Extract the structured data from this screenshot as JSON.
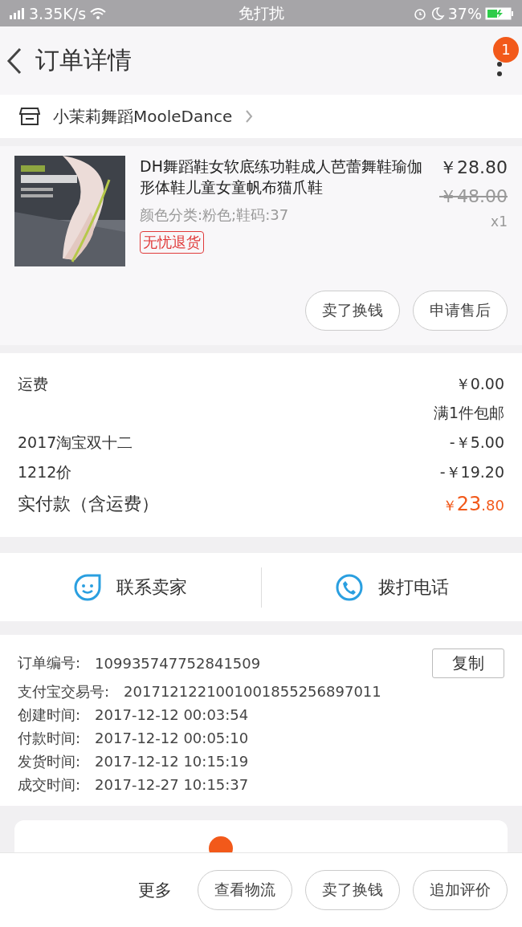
{
  "status_bar": {
    "speed": "3.35K/s",
    "mode": "免打扰",
    "battery": "37%"
  },
  "header": {
    "title": "订单详情",
    "badge": "1"
  },
  "shop": {
    "name": "小茉莉舞蹈MooleDance"
  },
  "product": {
    "title": "DH舞蹈鞋女软底练功鞋成人芭蕾舞鞋瑜伽形体鞋儿童女童帆布猫爪鞋",
    "variant": "颜色分类:粉色;鞋码:37",
    "tag": "无忧退货",
    "price": "￥28.80",
    "original_price": "￥48.00",
    "quantity": "x1",
    "buttons": [
      "卖了换钱",
      "申请售后"
    ]
  },
  "fees": [
    {
      "label": "运费",
      "value": "￥0.00",
      "kind": "plain"
    },
    {
      "value": "满1件包邮",
      "kind": "note"
    },
    {
      "label": "2017淘宝双十二",
      "value": "-￥5.00",
      "kind": "plain"
    },
    {
      "label": "1212价",
      "value": "-￥19.20",
      "kind": "plain"
    }
  ],
  "total": {
    "label": "实付款（含运费）",
    "currency": "￥",
    "integer": "23",
    "decimal": ".80"
  },
  "contact": [
    {
      "label": "联系卖家",
      "kind": "chat"
    },
    {
      "label": "拨打电话",
      "kind": "phone"
    }
  ],
  "order_info": [
    {
      "label": "订单编号:",
      "value": "109935747752841509"
    },
    {
      "label": "支付宝交易号:",
      "value": "2017121221001001855256897011"
    },
    {
      "label": "创建时间:",
      "value": "2017-12-12 00:03:54"
    },
    {
      "label": "付款时间:",
      "value": "2017-12-12 00:05:10"
    },
    {
      "label": "发货时间:",
      "value": "2017-12-12 10:15:19"
    },
    {
      "label": "成交时间:",
      "value": "2017-12-27 10:15:37"
    }
  ],
  "copy_button": "复制",
  "bottom_bar": {
    "more": "更多",
    "buttons": [
      "查看物流",
      "卖了换钱",
      "追加评价"
    ]
  }
}
